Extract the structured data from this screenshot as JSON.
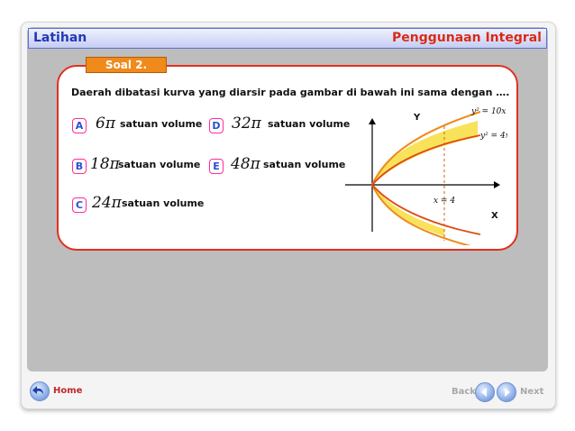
{
  "header": {
    "left_title": "Latihan",
    "right_title": "Penggunaan Integral"
  },
  "soal_label": "Soal 2.",
  "question": "Daerah dibatasi kurva yang diarsir pada gambar di bawah ini sama dengan ….",
  "options": [
    {
      "letter": "A",
      "value": "6π",
      "unit": "satuan  volume"
    },
    {
      "letter": "B",
      "value": "18π",
      "unit": "satuan volume"
    },
    {
      "letter": "C",
      "value": "24π",
      "unit": "satuan volume"
    },
    {
      "letter": "D",
      "value": "32π",
      "unit": "satuan volume"
    },
    {
      "letter": "E",
      "value": "48π",
      "unit": "satuan  volume"
    }
  ],
  "graph": {
    "y_axis": "Y",
    "x_axis": "X",
    "curve1": "y² = 10x",
    "curve2": "y² = 4x",
    "line": "x = 4",
    "colors": {
      "fill": "#f7e25a",
      "curve_outer": "#f08a1a",
      "curve_inner": "#e04a10",
      "dashed": "#e05a10"
    }
  },
  "nav": {
    "home": "Home",
    "back": "Back",
    "next": "Next"
  },
  "icons": [
    "home-icon",
    "back-arrow-icon",
    "next-arrow-icon"
  ]
}
